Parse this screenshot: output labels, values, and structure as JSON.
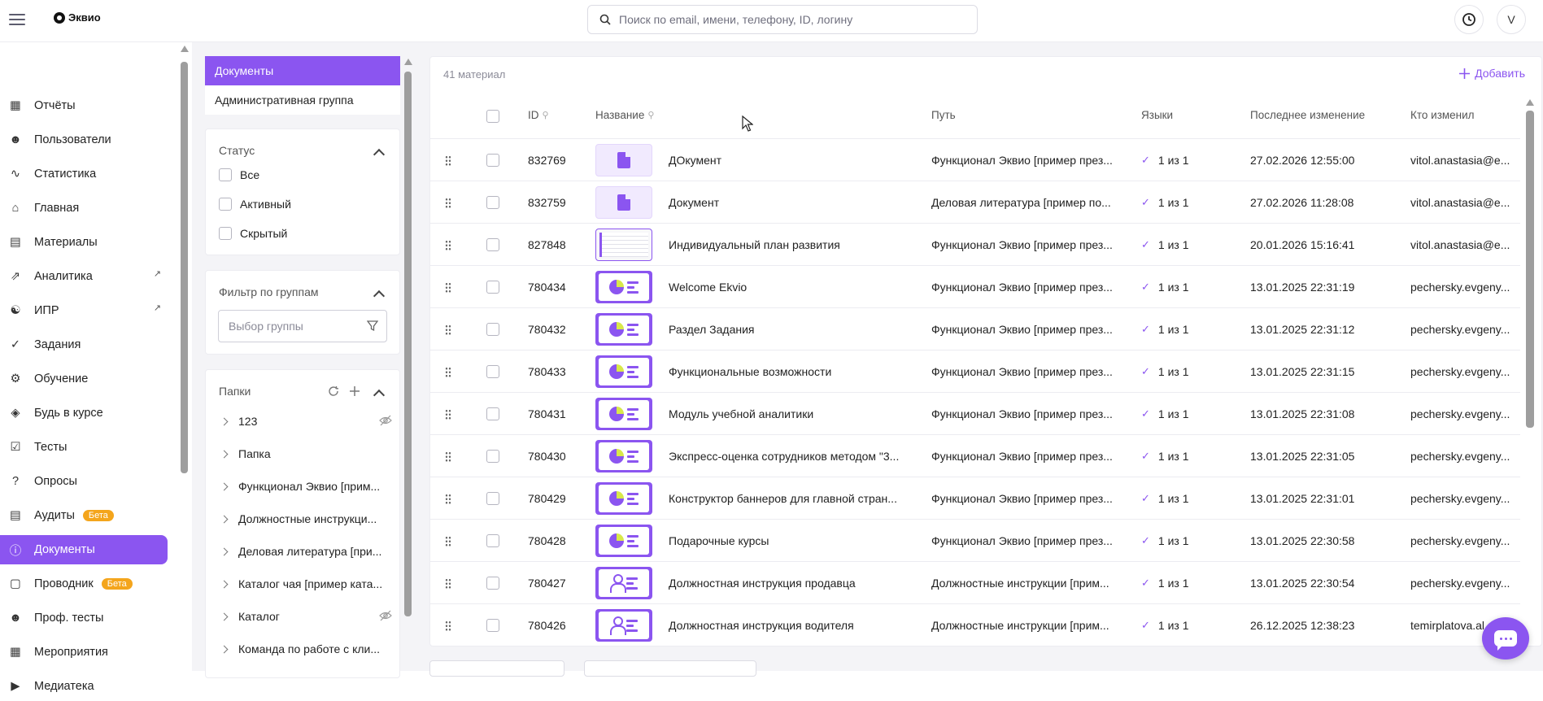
{
  "header": {
    "logo_text": "Эквио",
    "search_placeholder": "Поиск по email, имени, телефону, ID, логину",
    "avatar_letter": "V"
  },
  "sidebar": {
    "items": [
      {
        "label": "Отчёты",
        "icon": "reports-icon"
      },
      {
        "label": "Пользователи",
        "icon": "users-icon"
      },
      {
        "label": "Статистика",
        "icon": "statistics-icon"
      },
      {
        "label": "Главная",
        "icon": "home-icon"
      },
      {
        "label": "Материалы",
        "icon": "materials-icon"
      },
      {
        "label": "Аналитика",
        "icon": "analytics-icon",
        "external": true
      },
      {
        "label": "ИПР",
        "icon": "ipr-icon",
        "external": true
      },
      {
        "label": "Задания",
        "icon": "tasks-icon"
      },
      {
        "label": "Обучение",
        "icon": "learning-icon"
      },
      {
        "label": "Будь в курсе",
        "icon": "news-icon"
      },
      {
        "label": "Тесты",
        "icon": "tests-icon"
      },
      {
        "label": "Опросы",
        "icon": "surveys-icon"
      },
      {
        "label": "Аудиты",
        "icon": "audits-icon",
        "badge": "Бета"
      },
      {
        "label": "Документы",
        "icon": "documents-icon",
        "active": true
      },
      {
        "label": "Проводник",
        "icon": "explorer-icon",
        "badge": "Бета"
      },
      {
        "label": "Проф. тесты",
        "icon": "prof-tests-icon"
      },
      {
        "label": "Мероприятия",
        "icon": "events-icon"
      },
      {
        "label": "Медиатека",
        "icon": "media-library-icon"
      }
    ]
  },
  "filters": {
    "tab_documents": "Документы",
    "tab_admin_group": "Административная группа",
    "status_title": "Статус",
    "status_options": [
      "Все",
      "Активный",
      "Скрытый"
    ],
    "group_filter_title": "Фильтр по группам",
    "group_select_placeholder": "Выбор группы",
    "folders_title": "Папки",
    "folders": [
      {
        "label": "123",
        "hidden": true
      },
      {
        "label": "Папка"
      },
      {
        "label": "Функционал Эквио [прим..."
      },
      {
        "label": "Должностные инструкци..."
      },
      {
        "label": "Деловая литература [при..."
      },
      {
        "label": "Каталог чая [пример ката..."
      },
      {
        "label": "Каталог",
        "hidden": true
      },
      {
        "label": "Команда по работе с кли..."
      }
    ]
  },
  "table": {
    "count": "41 материал",
    "add_label": "Добавить",
    "columns": {
      "id": "ID",
      "name": "Название",
      "path": "Путь",
      "languages": "Языки",
      "modified": "Последнее изменение",
      "modified_by": "Кто изменил"
    },
    "rows": [
      {
        "id": "832769",
        "thumb": "doc",
        "name": "ДОкумент",
        "path": "Функционал Эквио [пример през...",
        "lang": "1 из 1",
        "modified": "27.02.2026 12:55:00",
        "by": "vitol.anastasia@e..."
      },
      {
        "id": "832759",
        "thumb": "doc",
        "name": "Документ",
        "path": "Деловая литература [пример по...",
        "lang": "1 из 1",
        "modified": "27.02.2026 11:28:08",
        "by": "vitol.anastasia@e..."
      },
      {
        "id": "827848",
        "thumb": "shot",
        "name": "Индивидуальный план развития",
        "path": "Функционал Эквио [пример през...",
        "lang": "1 из 1",
        "modified": "20.01.2026 15:16:41",
        "by": "vitol.anastasia@e..."
      },
      {
        "id": "780434",
        "thumb": "pie",
        "name": "Welcome Ekvio",
        "path": "Функционал Эквио [пример през...",
        "lang": "1 из 1",
        "modified": "13.01.2025 22:31:19",
        "by": "pechersky.evgeny..."
      },
      {
        "id": "780432",
        "thumb": "pie",
        "name": "Раздел Задания",
        "path": "Функционал Эквио [пример през...",
        "lang": "1 из 1",
        "modified": "13.01.2025 22:31:12",
        "by": "pechersky.evgeny..."
      },
      {
        "id": "780433",
        "thumb": "pie",
        "name": "Функциональные возможности",
        "path": "Функционал Эквио [пример през...",
        "lang": "1 из 1",
        "modified": "13.01.2025 22:31:15",
        "by": "pechersky.evgeny..."
      },
      {
        "id": "780431",
        "thumb": "pie",
        "name": "Модуль учебной аналитики",
        "path": "Функционал Эквио [пример през...",
        "lang": "1 из 1",
        "modified": "13.01.2025 22:31:08",
        "by": "pechersky.evgeny..."
      },
      {
        "id": "780430",
        "thumb": "pie",
        "name": "Экспресс-оценка сотрудников методом \"3...",
        "path": "Функционал Эквио [пример през...",
        "lang": "1 из 1",
        "modified": "13.01.2025 22:31:05",
        "by": "pechersky.evgeny..."
      },
      {
        "id": "780429",
        "thumb": "pie",
        "name": "Конструктор баннеров для главной стран...",
        "path": "Функционал Эквио [пример през...",
        "lang": "1 из 1",
        "modified": "13.01.2025 22:31:01",
        "by": "pechersky.evgeny..."
      },
      {
        "id": "780428",
        "thumb": "pie",
        "name": "Подарочные курсы",
        "path": "Функционал Эквио [пример през...",
        "lang": "1 из 1",
        "modified": "13.01.2025 22:30:58",
        "by": "pechersky.evgeny..."
      },
      {
        "id": "780427",
        "thumb": "person",
        "name": "Должностная инструкция продавца",
        "path": "Должностные инструкции [прим...",
        "lang": "1 из 1",
        "modified": "13.01.2025 22:30:54",
        "by": "pechersky.evgeny..."
      },
      {
        "id": "780426",
        "thumb": "person",
        "name": "Должностная инструкция водителя",
        "path": "Должностные инструкции [прим...",
        "lang": "1 из 1",
        "modified": "26.12.2025 12:38:23",
        "by": "temirplatova.al..."
      }
    ]
  },
  "colors": {
    "accent": "#8b55f0",
    "badge": "#f4a51c"
  }
}
